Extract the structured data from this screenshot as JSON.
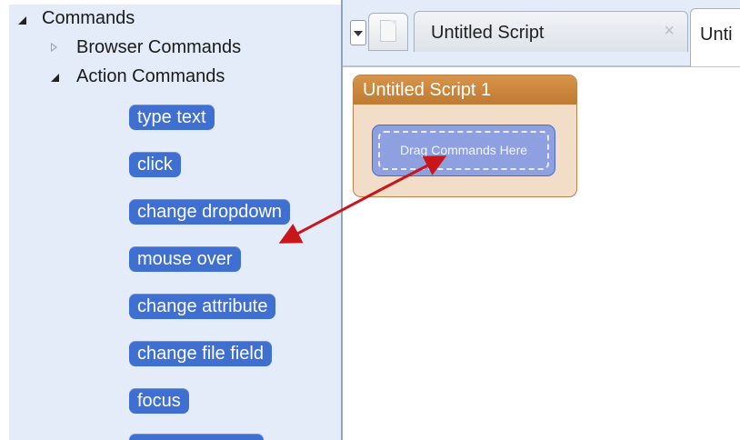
{
  "tree": {
    "root_label": "Commands",
    "children": [
      {
        "label": "Browser Commands",
        "expanded": false
      },
      {
        "label": "Action Commands",
        "expanded": true
      }
    ],
    "action_commands": [
      "type text",
      "click",
      "change dropdown",
      "mouse over",
      "change attribute",
      "change file field",
      "focus",
      ""
    ]
  },
  "tabs": {
    "items": [
      {
        "label": "Untitled Script",
        "close_icon": "×"
      },
      {
        "label": "Unti"
      }
    ]
  },
  "script": {
    "title": "Untitled Script 1",
    "drop_zone_text": "Drag Commands Here"
  },
  "colors": {
    "panel_bg": "#e3ecf8",
    "chip_blue": "#3e6fd1",
    "script_header": "#c9843c",
    "arrow": "#c8161a"
  }
}
